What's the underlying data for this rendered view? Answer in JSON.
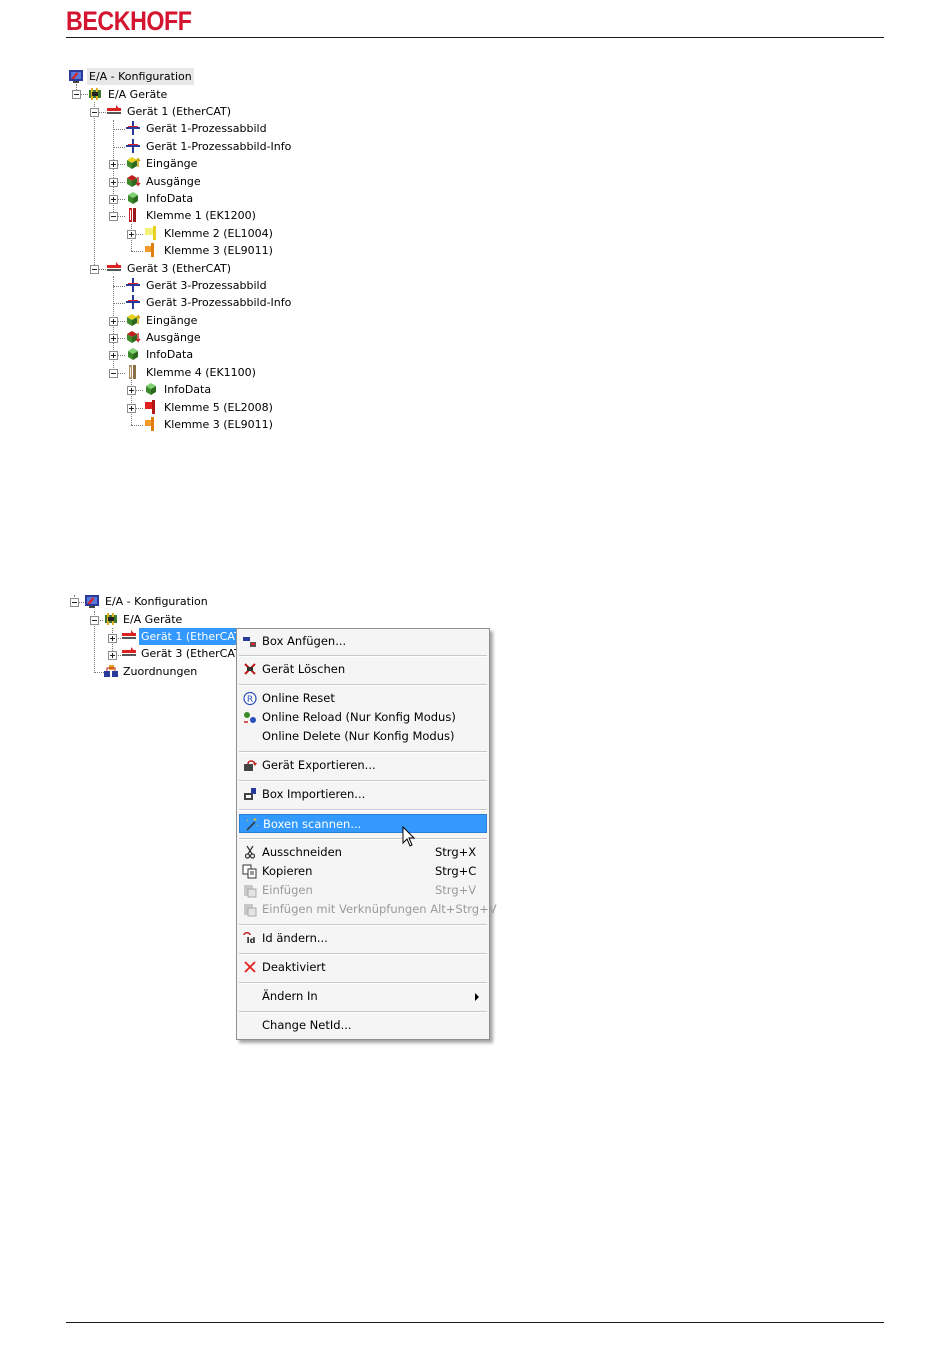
{
  "brand": {
    "logo": "BECKHOFF"
  },
  "tree1": {
    "root": "E/A - Konfiguration",
    "devices": "E/A Geräte",
    "geraet1": "Gerät 1 (EtherCAT)",
    "g1_pa": "Gerät 1-Prozessabbild",
    "g1_pai": "Gerät 1-Prozessabbild-Info",
    "g1_in": "Eingänge",
    "g1_out": "Ausgänge",
    "g1_info": "InfoData",
    "klemme1": "Klemme 1 (EK1200)",
    "klemme2": "Klemme 2 (EL1004)",
    "klemme3a": "Klemme 3 (EL9011)",
    "geraet3": "Gerät 3 (EtherCAT)",
    "g3_pa": "Gerät 3-Prozessabbild",
    "g3_pai": "Gerät 3-Prozessabbild-Info",
    "g3_in": "Eingänge",
    "g3_out": "Ausgänge",
    "g3_info": "InfoData",
    "klemme4": "Klemme 4 (EK1100)",
    "k4_info": "InfoData",
    "klemme5": "Klemme 5 (EL2008)",
    "klemme3b": "Klemme 3 (EL9011)"
  },
  "tree2": {
    "root": "E/A - Konfiguration",
    "devices": "E/A Geräte",
    "geraet1": "Gerät 1 (EtherCAT)",
    "geraet3": "Gerät 3 (EtherCAT)",
    "mappings": "Zuordnungen"
  },
  "menu": {
    "box_add": "Box Anfügen...",
    "device_delete": "Gerät Löschen",
    "online_reset": "Online Reset",
    "online_reload": "Online Reload (Nur Konfig Modus)",
    "online_delete": "Online Delete (Nur Konfig Modus)",
    "device_export": "Gerät Exportieren...",
    "box_import": "Box Importieren...",
    "scan_boxes": "Boxen scannen...",
    "cut": "Ausschneiden",
    "cut_sc": "Strg+X",
    "copy": "Kopieren",
    "copy_sc": "Strg+C",
    "paste": "Einfügen",
    "paste_sc": "Strg+V",
    "paste_links": "Einfügen mit Verknüpfungen Alt+Strg+V",
    "change_id": "Id ändern...",
    "deactivated": "Deaktiviert",
    "change_to": "Ändern In",
    "change_netid": "Change NetId..."
  },
  "colors": {
    "brand_red": "#d3152f",
    "selection": "#3399ff"
  }
}
